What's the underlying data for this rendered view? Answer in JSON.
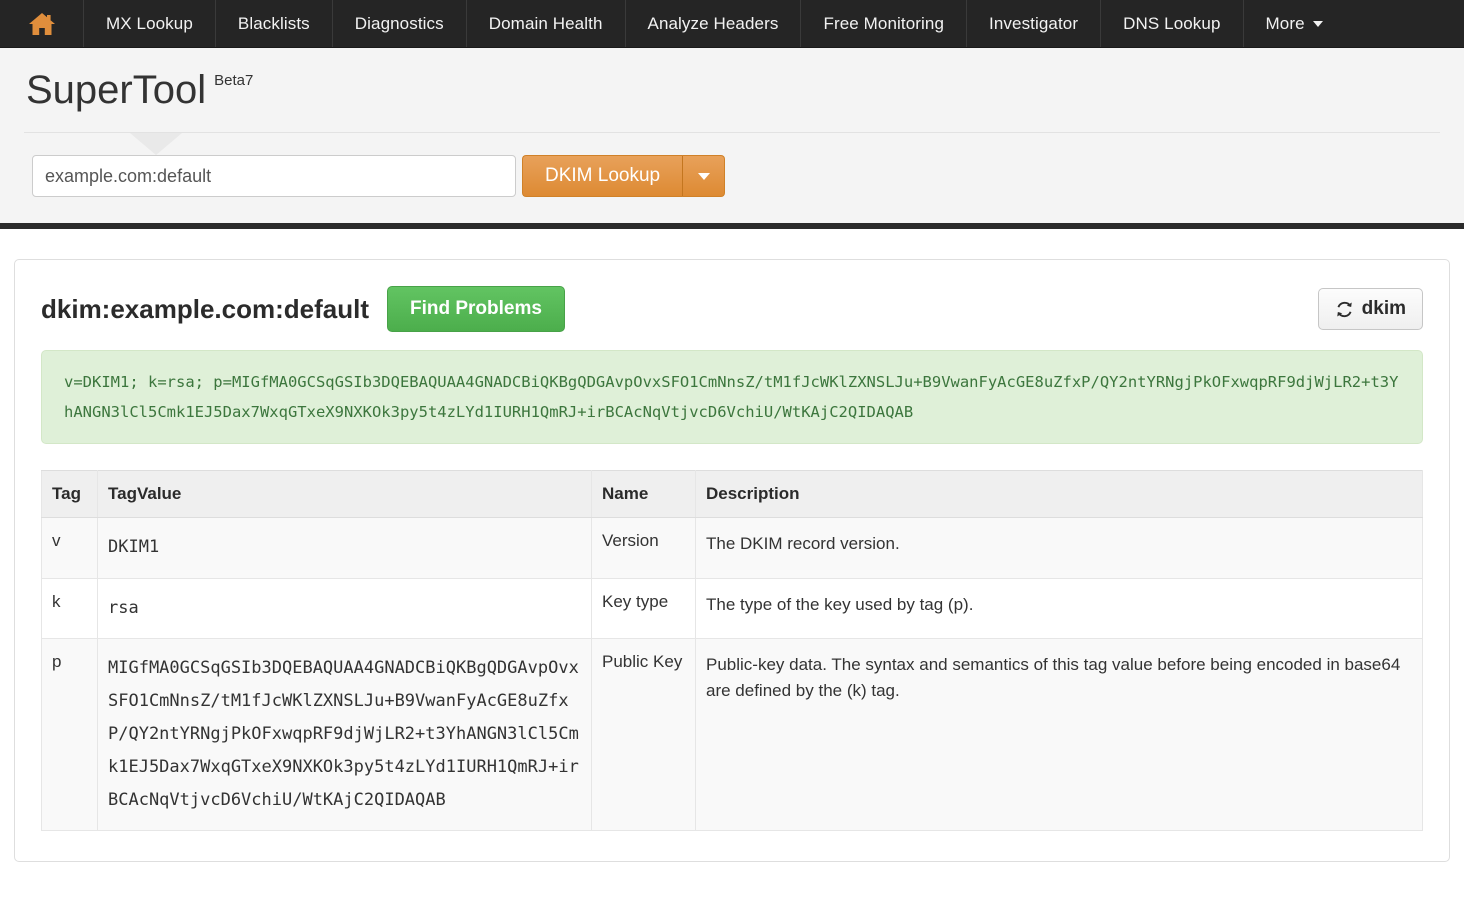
{
  "nav": {
    "home_icon": "home-icon",
    "items": [
      {
        "label": "MX Lookup"
      },
      {
        "label": "Blacklists"
      },
      {
        "label": "Diagnostics"
      },
      {
        "label": "Domain Health"
      },
      {
        "label": "Analyze Headers"
      },
      {
        "label": "Free Monitoring"
      },
      {
        "label": "Investigator"
      },
      {
        "label": "DNS Lookup"
      },
      {
        "label": "More"
      }
    ]
  },
  "header": {
    "title": "SuperTool",
    "badge": "Beta7"
  },
  "search": {
    "value": "example.com:default",
    "placeholder": "example.com:default",
    "button_label": "DKIM Lookup",
    "dropdown_icon": "chevron-down-icon"
  },
  "results": {
    "title": "dkim:example.com:default",
    "find_problems_label": "Find Problems",
    "refresh_label": "dkim",
    "refresh_icon": "refresh-icon",
    "record": "v=DKIM1; k=rsa; p=MIGfMA0GCSqGSIb3DQEBAQUAA4GNADCBiQKBgQDGAvpOvxSFO1CmNnsZ/tM1fJcWKlZXNSLJu+B9VwanFyAcGE8uZfxP/QY2ntYRNgjPkOFxwqpRF9djWjLR2+t3YhANGN3lCl5Cmk1EJ5Dax7WxqGTxeX9NXKOk3py5t4zLYd1IURH1QmRJ+irBCAcNqVtjvcD6VchiU/WtKAjC2QIDAQAB",
    "table": {
      "columns": [
        "Tag",
        "TagValue",
        "Name",
        "Description"
      ],
      "rows": [
        {
          "tag": "v",
          "value": "DKIM1",
          "name": "Version",
          "description": "The DKIM record version."
        },
        {
          "tag": "k",
          "value": "rsa",
          "name": "Key type",
          "description": "The type of the key used by tag (p)."
        },
        {
          "tag": "p",
          "value": "MIGfMA0GCSqGSIb3DQEBAQUAA4GNADCBiQKBgQDGAvpOvxSFO1CmNnsZ/tM1fJcWKlZXNSLJu+B9VwanFyAcGE8uZfxP/QY2ntYRNgjPkOFxwqpRF9djWjLR2+t3YhANGN3lCl5Cmk1EJ5Dax7WxqGTxeX9NXKOk3py5t4zLYd1IURH1QmRJ+irBCAcNqVtjvcD6VchiU/WtKAjC2QIDAQAB",
          "name": "Public Key",
          "description": "Public-key data. The syntax and semantics of this tag value before being encoded in base64 are defined by the (k) tag."
        }
      ]
    }
  },
  "colors": {
    "nav_bg": "#252525",
    "accent_orange": "#dd8a33",
    "accent_green": "#4cae4c",
    "record_bg": "#dff0d8",
    "record_text": "#3c763d"
  }
}
